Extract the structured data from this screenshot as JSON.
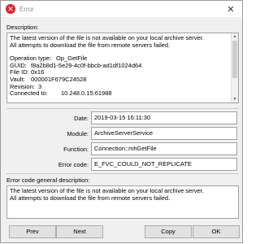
{
  "window": {
    "title": "Error",
    "close_glyph": "✕",
    "title_icon_glyph": "✕",
    "title_icon_color": "#e3202a"
  },
  "description": {
    "label": "Description:",
    "message_line1": "The latest version of the file is not available on your local archive server.",
    "message_line2": "All attempts to download the file from remote servers failed.",
    "details": [
      {
        "key": "Operation type:",
        "value": "Op_GetFile"
      },
      {
        "key": "GUID:",
        "value": "f8a2b8d1-5e29-4c0f-bbcb-ad1df1024d64"
      },
      {
        "key": "File ID:",
        "value": "0x16"
      },
      {
        "key": "Vault:",
        "value": "000001F679C24528"
      },
      {
        "key": "Revision:",
        "value": "3"
      },
      {
        "key": "Connected to:",
        "value": "10.248.0.15:61988"
      }
    ]
  },
  "fields": {
    "date_label": "Date:",
    "date_value": "2019-03-15 16:11:30",
    "module_label": "Module:",
    "module_value": "ArchiveServerService",
    "function_label": "Function:",
    "function_value": "Connection::mhGetFile",
    "error_code_label": "Error code:",
    "error_code_value": "E_FVC_COULD_NOT_REPLICATE"
  },
  "general": {
    "label": "Error code general description:",
    "line1": "The latest version of the file is not available on your local archive server.",
    "line2": "All attempts to download the file from remote servers failed."
  },
  "buttons": {
    "prev": "Prev",
    "next": "Next",
    "copy": "Copy",
    "ok": "OK"
  }
}
